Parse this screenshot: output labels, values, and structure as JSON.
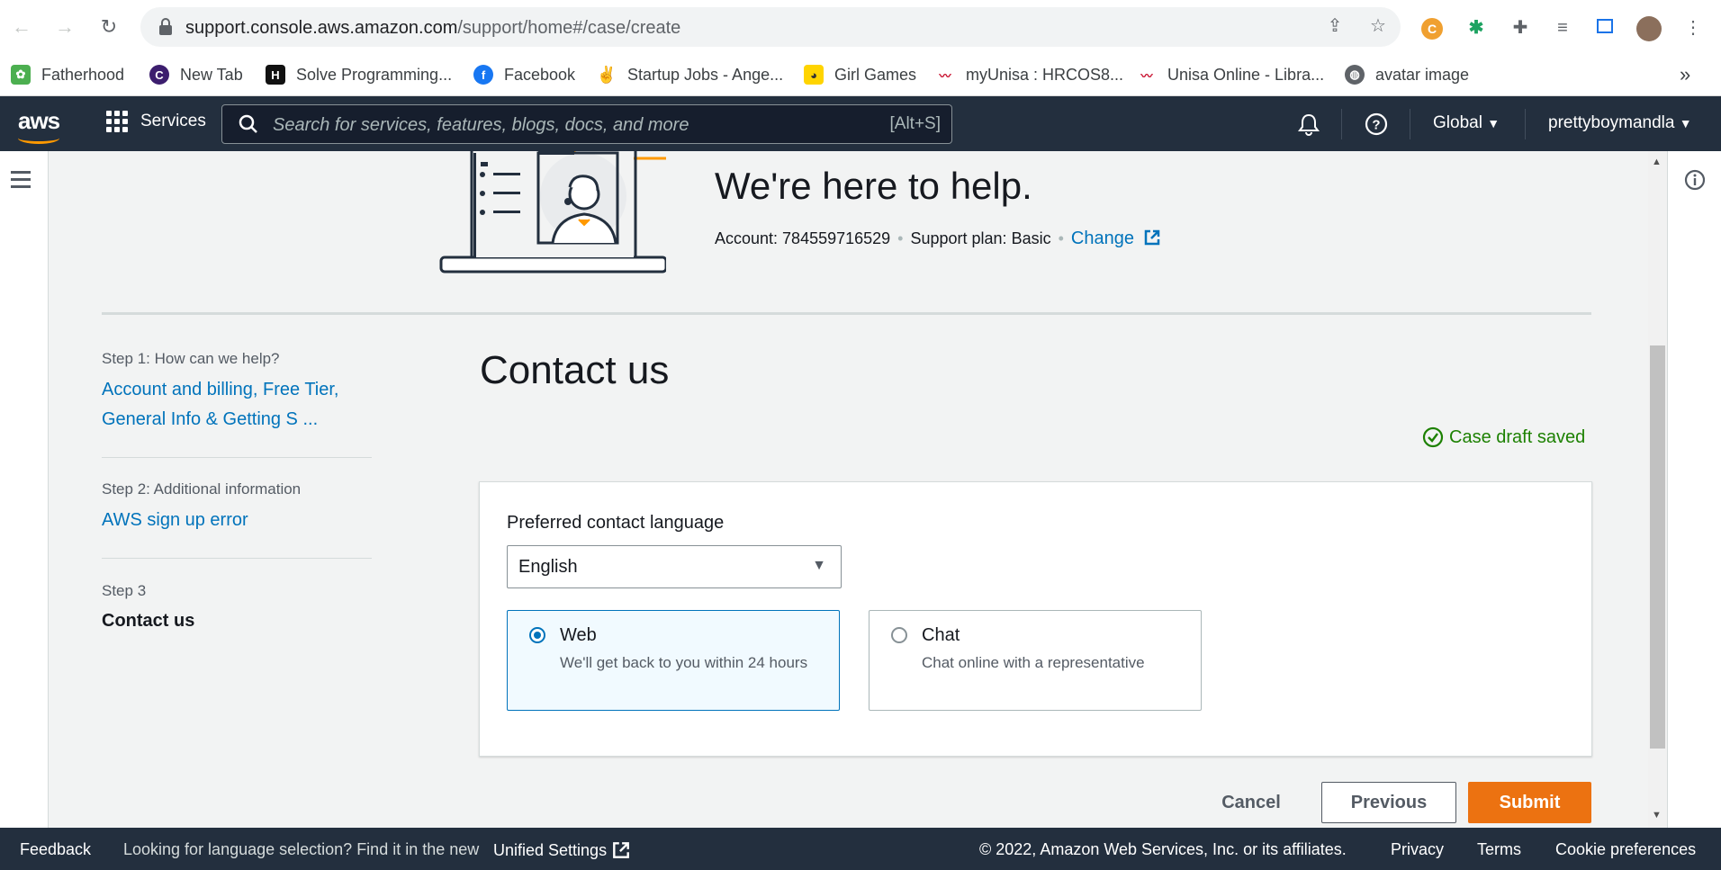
{
  "browser": {
    "url_host": "support.console.aws.amazon.com",
    "url_path": "/support/home#/case/create",
    "bookmarks": [
      {
        "label": "Fatherhood",
        "icon": "plant-icon",
        "color": "#4caf50"
      },
      {
        "label": "New Tab",
        "icon": "c-circle-icon",
        "color": "#3c1e6e"
      },
      {
        "label": "Solve Programming...",
        "icon": "hackerrank-icon",
        "color": "#111111"
      },
      {
        "label": "Facebook",
        "icon": "facebook-icon",
        "color": "#1877f2"
      },
      {
        "label": "Startup Jobs - Ange...",
        "icon": "victory-hand-icon",
        "color": "#222222"
      },
      {
        "label": "Girl Games",
        "icon": "girl-games-icon",
        "color": "#ffd400"
      },
      {
        "label": "myUnisa : HRCOS8...",
        "icon": "unisa-icon",
        "color": "#c8102e"
      },
      {
        "label": "Unisa Online - Libra...",
        "icon": "unisa-icon",
        "color": "#c8102e"
      },
      {
        "label": "avatar image",
        "icon": "globe-icon",
        "color": "#5f6368"
      }
    ],
    "more_bookmarks": "»"
  },
  "aws_header": {
    "logo": "aws",
    "services_label": "Services",
    "search_placeholder": "Search for services, features, blogs, docs, and more",
    "search_shortcut": "[Alt+S]",
    "region": "Global",
    "user": "prettyboymandla"
  },
  "hero": {
    "title": "We're here to help.",
    "account_label": "Account: 784559716529",
    "plan_label": "Support plan: Basic",
    "change_link": "Change"
  },
  "steps": [
    {
      "label": "Step 1: How can we help?",
      "value": "Account and billing, Free Tier, General Info & Getting S ..."
    },
    {
      "label": "Step 2: Additional information",
      "value": "AWS sign up error"
    },
    {
      "label": "Step 3",
      "value": "Contact us"
    }
  ],
  "main": {
    "title": "Contact us",
    "draft_status": "Case draft saved",
    "language_label": "Preferred contact language",
    "language_value": "English",
    "options": [
      {
        "title": "Web",
        "desc": "We'll get back to you within 24 hours",
        "selected": true
      },
      {
        "title": "Chat",
        "desc": "Chat online with a representative",
        "selected": false
      }
    ],
    "cancel_label": "Cancel",
    "previous_label": "Previous",
    "submit_label": "Submit"
  },
  "footer": {
    "feedback": "Feedback",
    "language_prompt": "Looking for language selection? Find it in the new",
    "unified_settings": "Unified Settings",
    "copyright": "© 2022, Amazon Web Services, Inc. or its affiliates.",
    "privacy": "Privacy",
    "terms": "Terms",
    "cookies": "Cookie preferences"
  },
  "colors": {
    "aws_dark": "#232f3e",
    "link_blue": "#0073bb",
    "submit_orange": "#ec7211",
    "success_green": "#1d8102"
  }
}
